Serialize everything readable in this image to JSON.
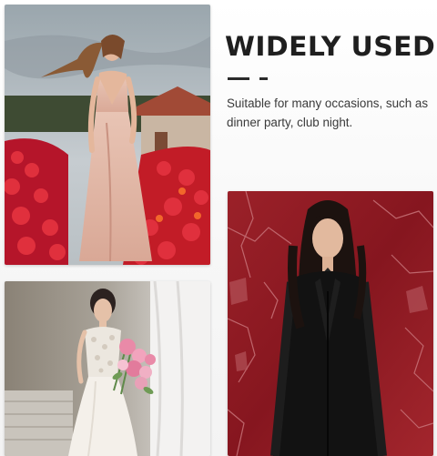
{
  "feature": {
    "title": "WIDELY USED",
    "description": "Suitable for many occasions, such as dinner party, club night."
  },
  "photos": [
    {
      "name": "woman in blush gown among red flowers",
      "icon": "photo-flower-field"
    },
    {
      "name": "bride in white lace dress with pink bouquet",
      "icon": "photo-bride"
    },
    {
      "name": "woman in black coat before red wall",
      "icon": "photo-black-coat"
    }
  ],
  "colors": {
    "title": "#1f1f1f",
    "text": "#3a3a3a",
    "divider": "#2a2a2a",
    "flowers": "#c7192b",
    "red_wall": "#8e1b22"
  }
}
